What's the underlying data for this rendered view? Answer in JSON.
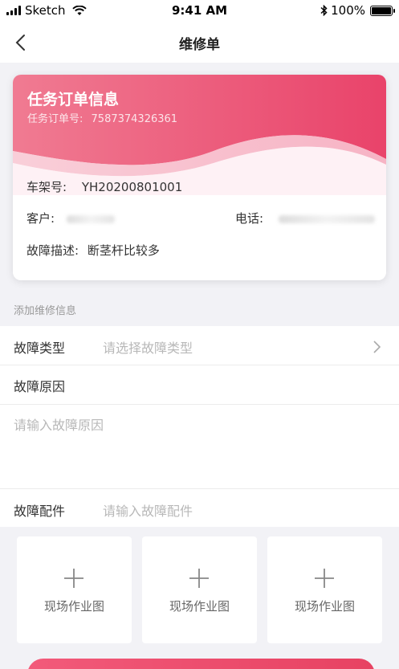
{
  "status_bar": {
    "carrier": "Sketch",
    "time": "9:41 AM",
    "battery": "100%"
  },
  "nav": {
    "title": "维修单",
    "back_icon": "chevron-left-icon"
  },
  "order_card": {
    "title": "任务订单信息",
    "order_no_label": "任务订单号:",
    "order_no": "7587374326361",
    "vin_label": "车架号:",
    "vin": "YH20200801001",
    "customer_label": "客户:",
    "phone_label": "电话:",
    "fault_desc_label": "故障描述:",
    "fault_desc": "断茎杆比较多",
    "colors": {
      "gradient_start": "#f07b92",
      "gradient_end": "#e9436a"
    }
  },
  "repair_section": {
    "heading": "添加维修信息",
    "fault_type_label": "故障类型",
    "fault_type_placeholder": "请选择故障类型",
    "fault_cause_label": "故障原因",
    "fault_cause_placeholder": "请输入故障原因",
    "fault_parts_label": "故障配件",
    "fault_parts_placeholder": "请输入故障配件"
  },
  "photos": [
    {
      "label": "现场作业图",
      "icon": "plus-icon"
    },
    {
      "label": "现场作业图",
      "icon": "plus-icon"
    },
    {
      "label": "现场作业图",
      "icon": "plus-icon"
    }
  ],
  "accent_color": "#e9436a"
}
